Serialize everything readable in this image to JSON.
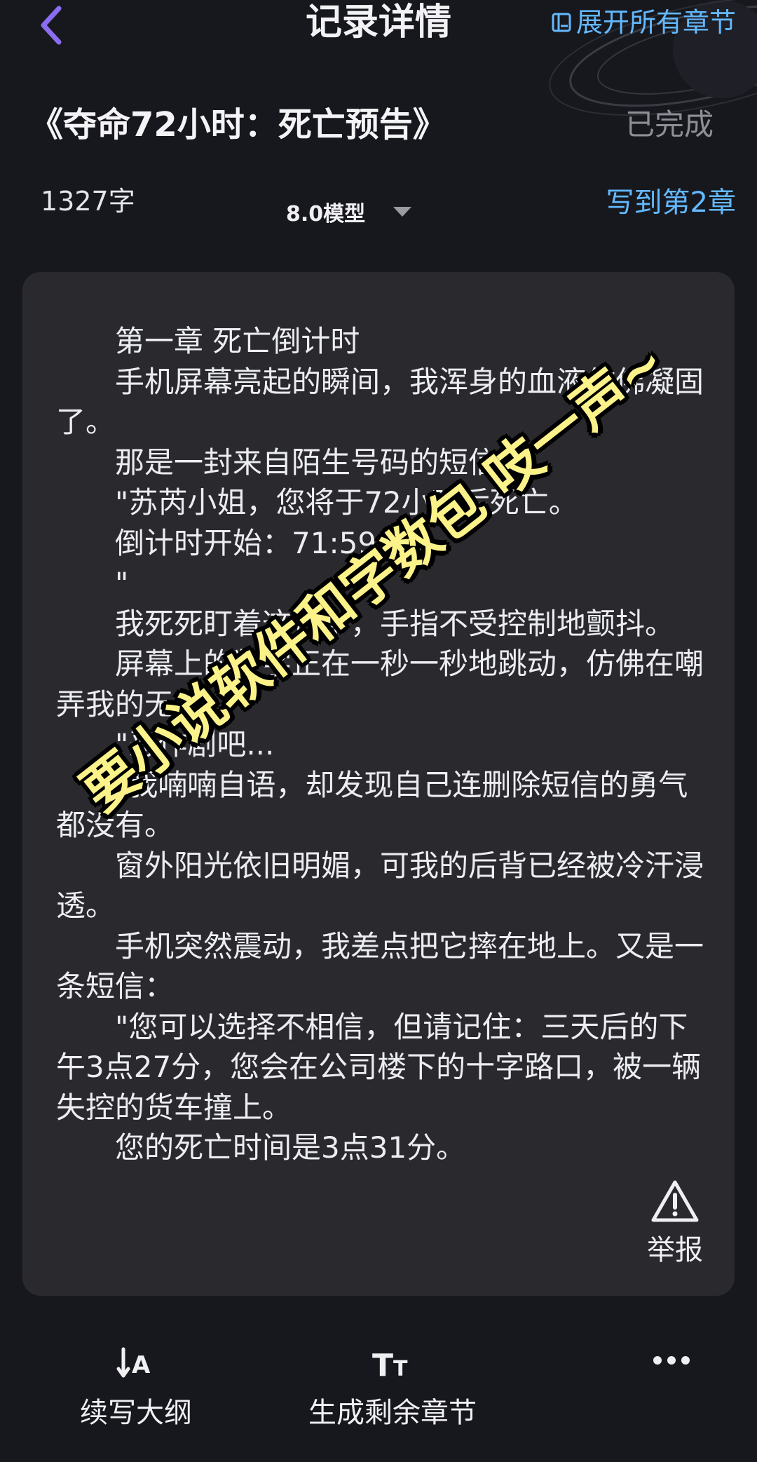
{
  "header": {
    "title": "记录详情",
    "expand_label": "展开所有章节"
  },
  "book": {
    "title": "《夺命72小时：死亡预告》",
    "status": "已完成",
    "word_count": "1327字",
    "model": "8.0模型",
    "write_to": "写到第2章"
  },
  "story": {
    "paragraphs": [
      "第一章 死亡倒计时",
      "手机屏幕亮起的瞬间，我浑身的血液仿佛凝固了。",
      "那是一封来自陌生号码的短信：",
      "\"苏芮小姐，您将于72小时后死亡。",
      "倒计时开始：71:59:58。",
      "\"",
      "我死死盯着这行字，手指不受控制地颤抖。",
      "屏幕上的数字正在一秒一秒地跳动，仿佛在嘲弄我的无措。",
      "\"恶作剧吧...",
      "\"我喃喃自语，却发现自己连删除短信的勇气都没有。",
      "窗外阳光依旧明媚，可我的后背已经被冷汗浸透。",
      "手机突然震动，我差点把它摔在地上。又是一条短信：",
      "\"您可以选择不相信，但请记住：三天后的下午3点27分，您会在公司楼下的十字路口，被一辆失控的货车撞上。",
      "您的死亡时间是3点31分。"
    ]
  },
  "report_label": "举报",
  "watermark": "要小说软件和字数包 吱一声~",
  "bottom": {
    "outline_label": "续写大纲",
    "generate_label": "生成剩余章节"
  },
  "colors": {
    "accent": "#63b9ff",
    "background": "#17181d",
    "card": "#29292e",
    "watermark": "#fbf28a"
  },
  "icons": [
    "back-chevron-icon",
    "expand-chapters-icon",
    "dropdown-caret-icon",
    "warning-icon",
    "outline-icon",
    "text-size-icon",
    "more-icon"
  ]
}
